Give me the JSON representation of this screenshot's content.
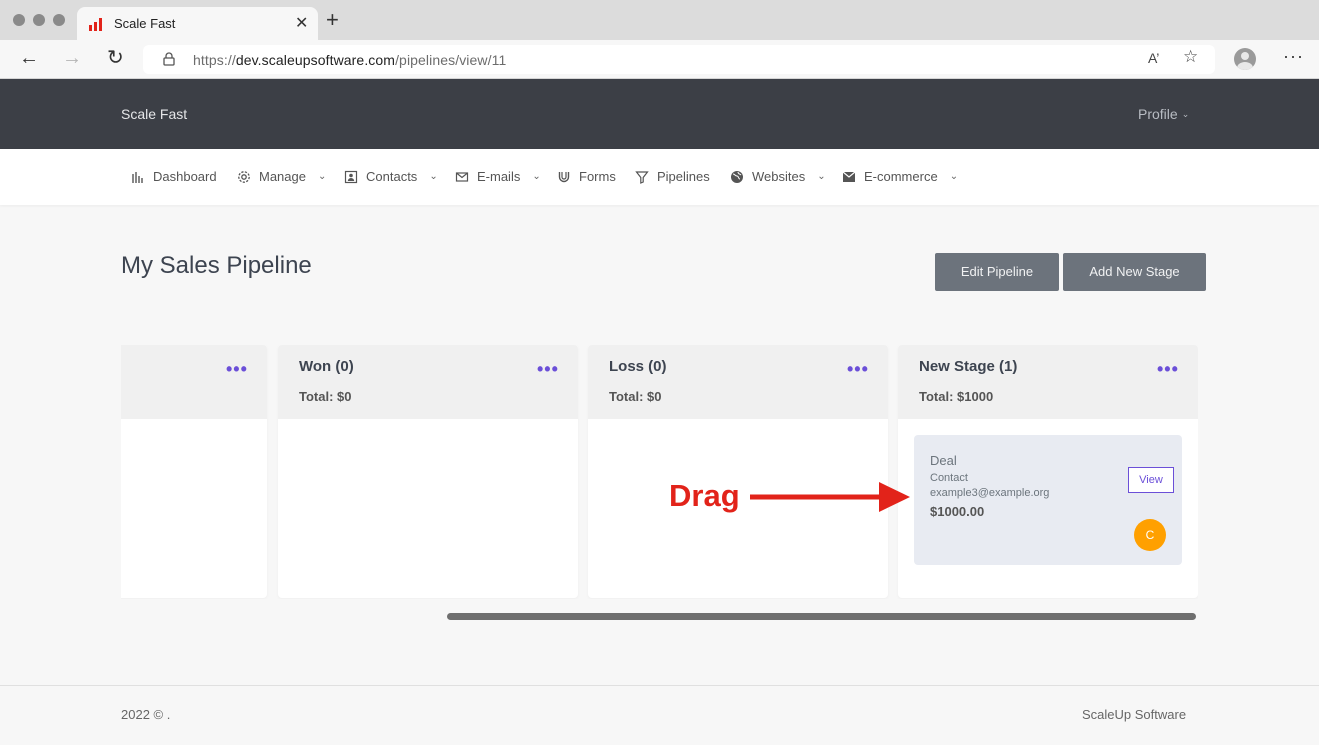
{
  "browser": {
    "tab_title": "Scale Fast",
    "tab_close": "✕",
    "new_tab": "+",
    "url_prefix": "https://",
    "url_host": "dev.scaleupsoftware.com",
    "url_path": "/pipelines/view/11",
    "back": "←",
    "forward": "→",
    "reload": "↻",
    "read_aloud": "A’",
    "favorites": "☆",
    "more": "···"
  },
  "app": {
    "brand": "Scale Fast",
    "profile": "Profile"
  },
  "menu": [
    {
      "label": "Dashboard",
      "icon": "bar-chart-icon",
      "caret": false
    },
    {
      "label": "Manage",
      "icon": "gear-icon",
      "caret": true
    },
    {
      "label": "Contacts",
      "icon": "contact-card-icon",
      "caret": true
    },
    {
      "label": "E-mails",
      "icon": "envelope-icon",
      "caret": true
    },
    {
      "label": "Forms",
      "icon": "magnet-icon",
      "caret": false
    },
    {
      "label": "Pipelines",
      "icon": "filter-icon",
      "caret": false
    },
    {
      "label": "Websites",
      "icon": "globe-icon",
      "caret": true
    },
    {
      "label": "E-commerce",
      "icon": "mail-box-icon",
      "caret": true
    }
  ],
  "page": {
    "title": "My Sales Pipeline",
    "edit_pipeline": "Edit Pipeline",
    "add_stage": "Add New Stage"
  },
  "stages": [
    {
      "name": "",
      "total": "",
      "dots": "•••"
    },
    {
      "name": "Won (0)",
      "total": "Total: $0",
      "dots": "•••"
    },
    {
      "name": "Loss (0)",
      "total": "Total: $0",
      "dots": "•••"
    },
    {
      "name": "New Stage (1)",
      "total": "Total: $1000",
      "dots": "•••"
    }
  ],
  "deal": {
    "title": "Deal",
    "contact": "Contact",
    "email": "example3@example.org",
    "value": "$1000.00",
    "view": "View",
    "avatar_initial": "C"
  },
  "annotation": {
    "drag_label": "Drag",
    "color": "#e2231a"
  },
  "footer": {
    "left": "2022 © .",
    "right": "ScaleUp Software"
  },
  "colors": {
    "header_bg": "#3c3f46",
    "accent": "#6b4fd8",
    "avatar": "#ffa000",
    "button": "#6c737c"
  }
}
